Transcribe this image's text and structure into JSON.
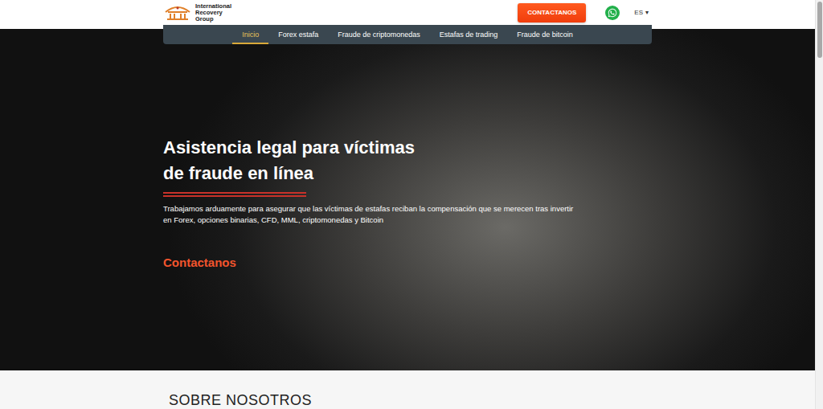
{
  "header": {
    "logo": [
      "International",
      "Recovery",
      "Group"
    ],
    "contact_button": "CONTACTANOS",
    "language": "ES",
    "language_arrow": "▾"
  },
  "nav": [
    {
      "label": "Inicio",
      "selected": true
    },
    {
      "label": "Forex estafa",
      "selected": false
    },
    {
      "label": "Fraude de criptomonedas",
      "selected": false
    },
    {
      "label": "Estafas de trading",
      "selected": false
    },
    {
      "label": "Fraude de bitcoin",
      "selected": false
    }
  ],
  "hero": {
    "title_lines": [
      "Asistencia legal para víctimas",
      "de fraude en línea"
    ],
    "text": "Trabajamos arduamente para asegurar que las víctimas de estafas reciban la compensación que se merecen tras invertir en Forex, opciones binarias, CFD, MML, criptomonedas y Bitcoin",
    "link": "Contactanos"
  },
  "about": {
    "heading": "SOBRE NOSOTROS"
  },
  "scrollbar": {
    "level": 0
  }
}
